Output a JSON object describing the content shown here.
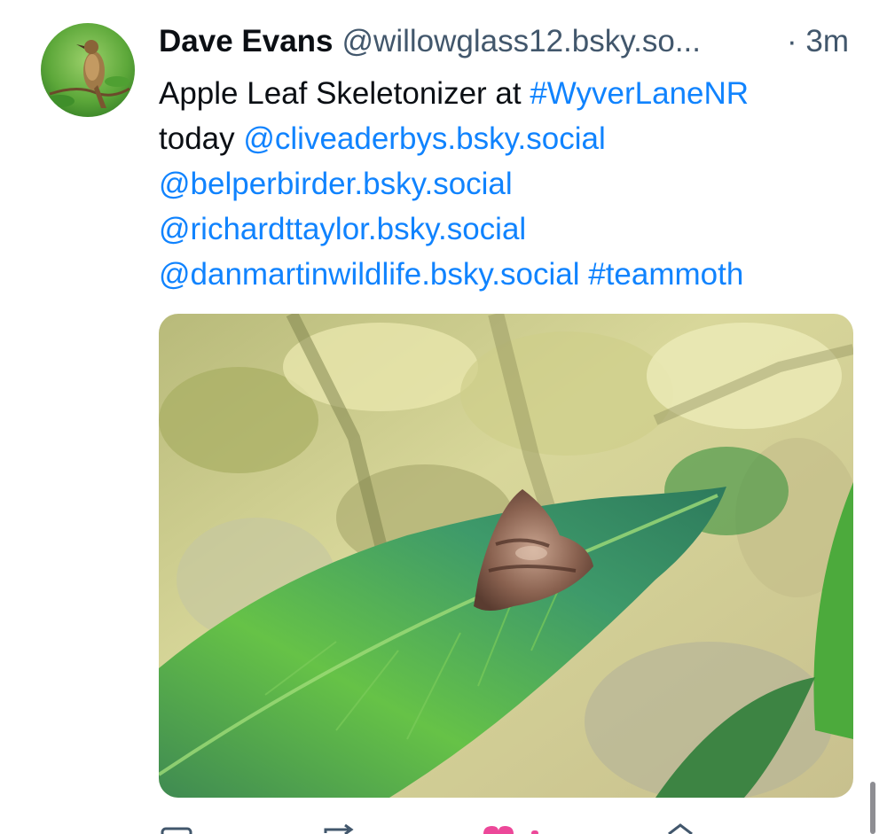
{
  "post": {
    "author_name": "Dave Evans",
    "author_handle": "@willowglass12.bsky.so...",
    "time": "· 3m",
    "text_lines": [
      [
        {
          "text": "Apple Leaf Skeletonizer at ",
          "link": false
        },
        {
          "text": "#WyverLaneNR",
          "link": true
        }
      ],
      [
        {
          "text": "today ",
          "link": false
        },
        {
          "text": "@cliveaderbys.bsky.social",
          "link": true
        }
      ],
      [
        {
          "text": "@belperbirder.bsky.social",
          "link": true
        }
      ],
      [
        {
          "text": "@richardttaylor.bsky.social",
          "link": true
        }
      ],
      [
        {
          "text": "@danmartinwildlife.bsky.social",
          "link": true
        },
        {
          "text": " ",
          "link": false
        },
        {
          "text": "#teammoth",
          "link": true
        }
      ]
    ]
  },
  "colors": {
    "link": "#1083fe",
    "text": "#0b0f14",
    "muted": "#42576c",
    "like": "#ec4899",
    "icon": "#42576c"
  },
  "actions": [
    {
      "name": "reply-icon",
      "color": "#42576c"
    },
    {
      "name": "repost-icon",
      "color": "#42576c"
    },
    {
      "name": "like-icon",
      "color": "#ec4899"
    },
    {
      "name": "more-icon",
      "color": "#42576c"
    }
  ]
}
